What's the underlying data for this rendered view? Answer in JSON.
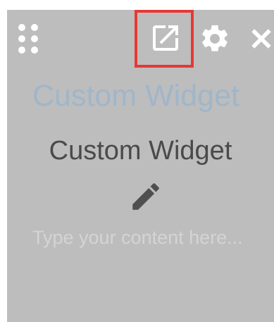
{
  "widget": {
    "ghost_title": "Custom Widget",
    "ghost_body": "Type your content here...",
    "overlay_title": "Custom Widget"
  },
  "toolbar": {
    "icons": [
      "drag-handle-icon",
      "open-in-new-icon",
      "gear-icon",
      "close-icon"
    ],
    "highlight_color": "#e53935"
  },
  "colors": {
    "overlay_bg": "#bdbdbd",
    "ghost_title": "#9fb6ca",
    "overlay_text": "#4a4a4a",
    "icon": "#ffffff"
  }
}
